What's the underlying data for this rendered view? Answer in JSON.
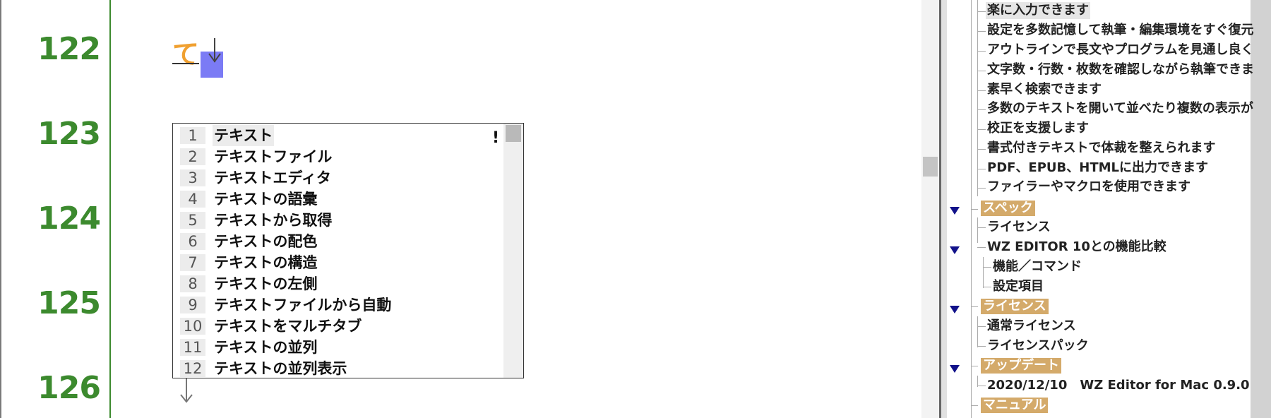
{
  "gutter": {
    "line_numbers": [
      "122",
      "123",
      "124",
      "125",
      "126"
    ]
  },
  "editor": {
    "composing_text": "て",
    "candidate_flag": "!",
    "candidates": [
      {
        "index": "1",
        "text": "テキスト"
      },
      {
        "index": "2",
        "text": "テキストファイル"
      },
      {
        "index": "3",
        "text": "テキストエディタ"
      },
      {
        "index": "4",
        "text": "テキストの語彙"
      },
      {
        "index": "5",
        "text": "テキストから取得"
      },
      {
        "index": "6",
        "text": "テキストの配色"
      },
      {
        "index": "7",
        "text": "テキストの構造"
      },
      {
        "index": "8",
        "text": "テキストの左側"
      },
      {
        "index": "9",
        "text": "テキストファイルから自動"
      },
      {
        "index": "10",
        "text": "テキストをマルチタブ"
      },
      {
        "index": "11",
        "text": "テキストの並列"
      },
      {
        "index": "12",
        "text": "テキストの並列表示"
      }
    ]
  },
  "outline": {
    "items": [
      "楽に入力できます",
      "設定を多数記憶して執筆・編集環境をすぐ復元",
      "アウトラインで長文やプログラムを見通し良く",
      "文字数・行数・枚数を確認しながら執筆できま",
      "素早く検索できます",
      "多数のテキストを開いて並べたり複数の表示が",
      "校正を支援します",
      "書式付きテキストで体裁を整えられます",
      "PDF、EPUB、HTMLに出力できます",
      "ファイラーやマクロを使用できます"
    ],
    "spec": {
      "label": "スペック",
      "license": "ライセンス",
      "compare": "WZ EDITOR 10との機能比較",
      "compare_children": [
        "機能／コマンド",
        "設定項目"
      ]
    },
    "license_section": {
      "label": "ライセンス",
      "children": [
        "通常ライセンス",
        "ライセンスパック"
      ]
    },
    "update": {
      "label": "アップデート",
      "children": [
        "2020/12/10　WZ Editor for Mac 0.9.0"
      ]
    },
    "manual": {
      "label": "マニュアル"
    }
  }
}
